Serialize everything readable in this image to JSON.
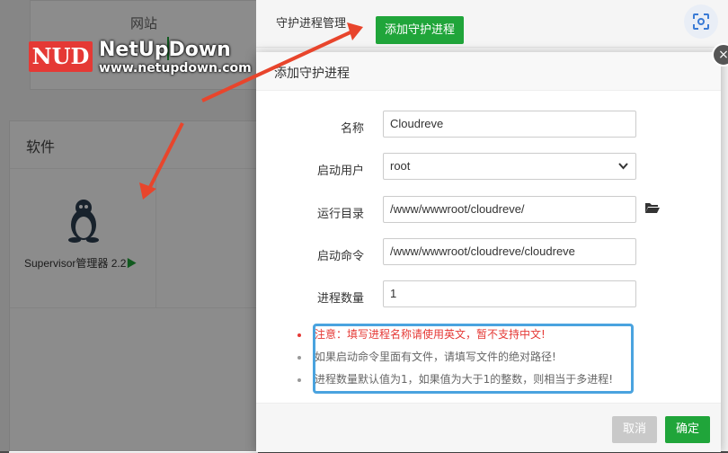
{
  "background": {
    "website_card_title": "网站",
    "software_card_title": "软件",
    "supervisor_label": "Supervisor管理器 2.2",
    "play_icon": "▶"
  },
  "panel": {
    "title": "守护进程管理",
    "add_button": "添加守护进程",
    "scan_icon": "scan-icon"
  },
  "modal": {
    "title": "添加守护进程",
    "close_icon": "close-icon",
    "fields": {
      "name": {
        "label": "名称",
        "value": "Cloudreve"
      },
      "user": {
        "label": "启动用户",
        "value": "root"
      },
      "dir": {
        "label": "运行目录",
        "value": "/www/wwwroot/cloudreve/"
      },
      "cmd": {
        "label": "启动命令",
        "value": "/www/wwwroot/cloudreve/cloudreve"
      },
      "count": {
        "label": "进程数量",
        "value": "1"
      }
    },
    "notes": [
      {
        "text": "注意：填写进程名称请使用英文，暂不支持中文!",
        "color": "#e53935"
      },
      {
        "text": "如果启动命令里面有文件，请填写文件的绝对路径!",
        "color": "#666666"
      },
      {
        "text": "进程数量默认值为1，如果值为大于1的整数，则相当于多进程!",
        "color": "#666666"
      }
    ],
    "cancel_label": "取消",
    "confirm_label": "确定"
  },
  "watermark": {
    "logo": "NUD",
    "name": "NetUpDown",
    "url": "www.netupdown.com"
  },
  "colors": {
    "accent_green": "#20a53a",
    "arrow_red": "#e8452c",
    "note_border": "#4aa3df"
  }
}
